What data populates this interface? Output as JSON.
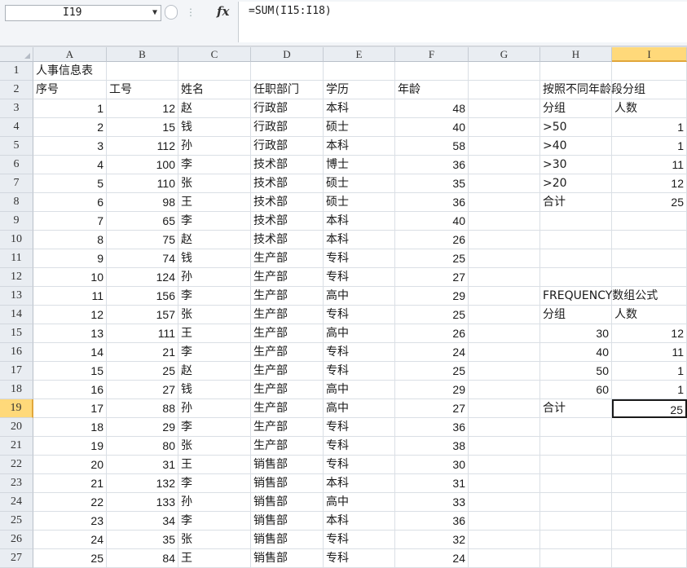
{
  "formula_bar": {
    "name_box": "I19",
    "fx": "fx",
    "formula": "=SUM(I15:I18)"
  },
  "columns": [
    "A",
    "B",
    "C",
    "D",
    "E",
    "F",
    "G",
    "H",
    "I"
  ],
  "selected_column": "I",
  "selected_row": 19,
  "active_cell": "I19",
  "rows": [
    {
      "row": 1,
      "A": "人事信息表"
    },
    {
      "row": 2,
      "A": "序号",
      "B": "工号",
      "C": "姓名",
      "D": "任职部门",
      "E": "学历",
      "F": "年龄",
      "H": "按照不同年龄段分组"
    },
    {
      "row": 3,
      "A": "1",
      "B": "12",
      "C": "赵",
      "D": "行政部",
      "E": "本科",
      "F": "48",
      "H": "分组",
      "I": "人数"
    },
    {
      "row": 4,
      "A": "2",
      "B": "15",
      "C": "钱",
      "D": "行政部",
      "E": "硕士",
      "F": "40",
      "H": ">50",
      "I": "1"
    },
    {
      "row": 5,
      "A": "3",
      "B": "112",
      "C": "孙",
      "D": "行政部",
      "E": "本科",
      "F": "58",
      "H": ">40",
      "I": "1"
    },
    {
      "row": 6,
      "A": "4",
      "B": "100",
      "C": "李",
      "D": "技术部",
      "E": "博士",
      "F": "36",
      "H": ">30",
      "I": "11"
    },
    {
      "row": 7,
      "A": "5",
      "B": "110",
      "C": "张",
      "D": "技术部",
      "E": "硕士",
      "F": "35",
      "H": ">20",
      "I": "12"
    },
    {
      "row": 8,
      "A": "6",
      "B": "98",
      "C": "王",
      "D": "技术部",
      "E": "硕士",
      "F": "36",
      "H": "合计",
      "I": "25"
    },
    {
      "row": 9,
      "A": "7",
      "B": "65",
      "C": "李",
      "D": "技术部",
      "E": "本科",
      "F": "40"
    },
    {
      "row": 10,
      "A": "8",
      "B": "75",
      "C": "赵",
      "D": "技术部",
      "E": "本科",
      "F": "26"
    },
    {
      "row": 11,
      "A": "9",
      "B": "74",
      "C": "钱",
      "D": "生产部",
      "E": "专科",
      "F": "25"
    },
    {
      "row": 12,
      "A": "10",
      "B": "124",
      "C": "孙",
      "D": "生产部",
      "E": "专科",
      "F": "27"
    },
    {
      "row": 13,
      "A": "11",
      "B": "156",
      "C": "李",
      "D": "生产部",
      "E": "高中",
      "F": "29",
      "H": "FREQUENCY数组公式"
    },
    {
      "row": 14,
      "A": "12",
      "B": "157",
      "C": "张",
      "D": "生产部",
      "E": "专科",
      "F": "25",
      "H": "分组",
      "I": "人数"
    },
    {
      "row": 15,
      "A": "13",
      "B": "111",
      "C": "王",
      "D": "生产部",
      "E": "高中",
      "F": "26",
      "H": "30",
      "I": "12"
    },
    {
      "row": 16,
      "A": "14",
      "B": "21",
      "C": "李",
      "D": "生产部",
      "E": "专科",
      "F": "24",
      "H": "40",
      "I": "11"
    },
    {
      "row": 17,
      "A": "15",
      "B": "25",
      "C": "赵",
      "D": "生产部",
      "E": "专科",
      "F": "25",
      "H": "50",
      "I": "1"
    },
    {
      "row": 18,
      "A": "16",
      "B": "27",
      "C": "钱",
      "D": "生产部",
      "E": "高中",
      "F": "29",
      "H": "60",
      "I": "1"
    },
    {
      "row": 19,
      "A": "17",
      "B": "88",
      "C": "孙",
      "D": "生产部",
      "E": "高中",
      "F": "27",
      "H": "合计",
      "I": "25"
    },
    {
      "row": 20,
      "A": "18",
      "B": "29",
      "C": "李",
      "D": "生产部",
      "E": "专科",
      "F": "36"
    },
    {
      "row": 21,
      "A": "19",
      "B": "80",
      "C": "张",
      "D": "生产部",
      "E": "专科",
      "F": "38"
    },
    {
      "row": 22,
      "A": "20",
      "B": "31",
      "C": "王",
      "D": "销售部",
      "E": "专科",
      "F": "30"
    },
    {
      "row": 23,
      "A": "21",
      "B": "132",
      "C": "李",
      "D": "销售部",
      "E": "本科",
      "F": "31"
    },
    {
      "row": 24,
      "A": "22",
      "B": "133",
      "C": "孙",
      "D": "销售部",
      "E": "高中",
      "F": "33"
    },
    {
      "row": 25,
      "A": "23",
      "B": "34",
      "C": "李",
      "D": "销售部",
      "E": "本科",
      "F": "36"
    },
    {
      "row": 26,
      "A": "24",
      "B": "35",
      "C": "张",
      "D": "销售部",
      "E": "专科",
      "F": "32"
    },
    {
      "row": 27,
      "A": "25",
      "B": "84",
      "C": "王",
      "D": "销售部",
      "E": "专科",
      "F": "24"
    }
  ]
}
